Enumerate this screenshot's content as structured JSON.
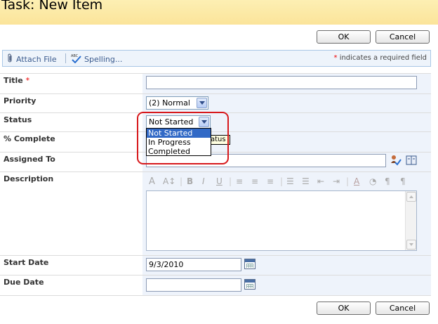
{
  "window": {
    "title": "Task: New Item"
  },
  "buttons": {
    "ok": "OK",
    "cancel": "Cancel"
  },
  "toolbar": {
    "attach_file": "Attach File",
    "spelling": "Spelling...",
    "required_star": "*",
    "required_note": " indicates a required field"
  },
  "fields": {
    "title": {
      "label": "Title",
      "required_star": "*",
      "value": ""
    },
    "priority": {
      "label": "Priority",
      "value": "(2) Normal"
    },
    "status": {
      "label": "Status",
      "value": "Not Started",
      "options": [
        "Not Started",
        "In Progress",
        "Completed"
      ],
      "tooltip": "atus"
    },
    "percent_complete": {
      "label": "% Complete"
    },
    "assigned_to": {
      "label": "Assigned To",
      "value": ""
    },
    "description": {
      "label": "Description",
      "value": ""
    },
    "start_date": {
      "label": "Start Date",
      "value": "9/3/2010"
    },
    "due_date": {
      "label": "Due Date",
      "value": ""
    }
  },
  "icons": {
    "attach": "paperclip-icon",
    "spelling": "spell-check-icon",
    "check_names": "check-names-icon",
    "address_book": "address-book-icon",
    "calendar": "calendar-icon"
  },
  "colors": {
    "title_bar": "#fbe49a",
    "field_background": "#eef3fb",
    "required": "#e00000",
    "highlight_circle": "#d7191c",
    "selected_option": "#3169c6"
  }
}
